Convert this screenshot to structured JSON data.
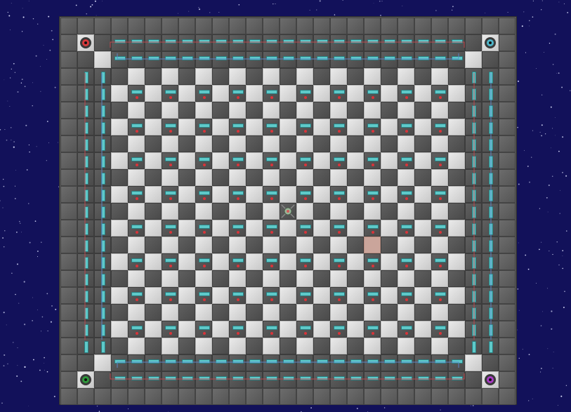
{
  "scene": {
    "background_color": "#12115a",
    "grid_columns": 27,
    "grid_rows": 23
  },
  "corner_markers": [
    {
      "name": "red-corner-marker",
      "color": "#d83a3c",
      "corner": "top-left"
    },
    {
      "name": "blue-corner-marker",
      "color": "#4fb6c9",
      "corner": "top-right"
    },
    {
      "name": "green-corner-marker",
      "color": "#2f9a3c",
      "corner": "bottom-left"
    },
    {
      "name": "purple-corner-marker",
      "color": "#a83bc4",
      "corner": "bottom-right"
    }
  ],
  "player": {
    "icon": "player-token-icon",
    "color": "#9ab89a"
  },
  "highlight_tile": {
    "color": "#caa59b"
  },
  "palette": {
    "slot": "#5ec9c9",
    "dot": "#d8343a",
    "wire_red": "#c0484e",
    "wire_blue": "#5b86c6"
  }
}
